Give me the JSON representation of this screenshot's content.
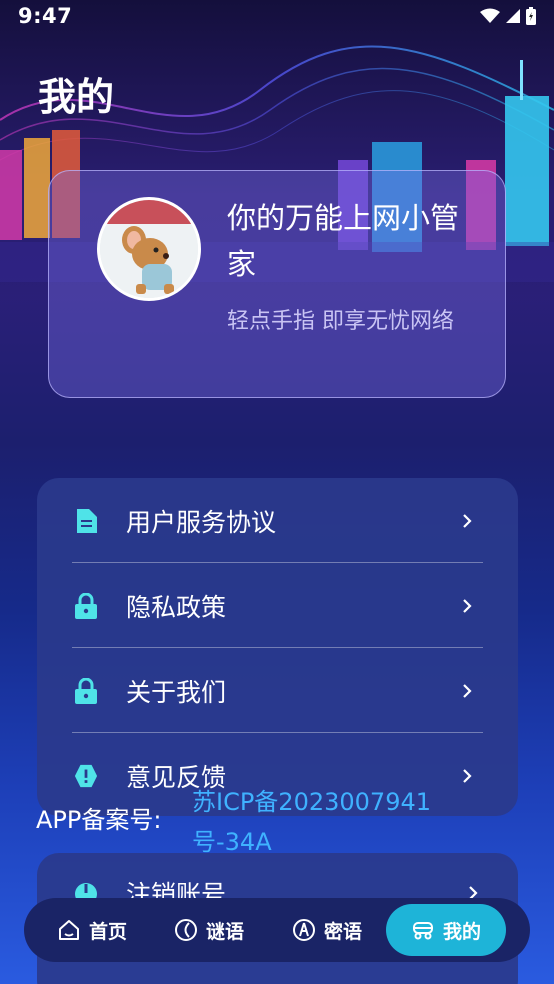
{
  "status_bar": {
    "time": "9:47"
  },
  "page": {
    "title": "我的"
  },
  "profile": {
    "name": "你的万能上网小管家",
    "subtitle": "轻点手指 即享无忧网络"
  },
  "menu": {
    "items": [
      {
        "label": "用户服务协议",
        "icon": "document-icon"
      },
      {
        "label": "隐私政策",
        "icon": "lock-icon"
      },
      {
        "label": "关于我们",
        "icon": "lock-icon"
      },
      {
        "label": "意见反馈",
        "icon": "alert-icon"
      }
    ]
  },
  "icp": {
    "label": "APP备案号:",
    "number": "苏ICP备2023007941号-34A"
  },
  "account": {
    "label": "注销账号",
    "icon": "power-icon"
  },
  "tabs": [
    {
      "label": "首页",
      "icon": "home-icon"
    },
    {
      "label": "谜语",
      "icon": "moon-icon"
    },
    {
      "label": "密语",
      "icon": "compass-icon"
    },
    {
      "label": "我的",
      "icon": "user-car-icon",
      "active": true
    }
  ],
  "colors": {
    "accent": "#1eb4d8",
    "icp_link": "#3fb2ff",
    "icon_teal": "#4fe3e8"
  }
}
